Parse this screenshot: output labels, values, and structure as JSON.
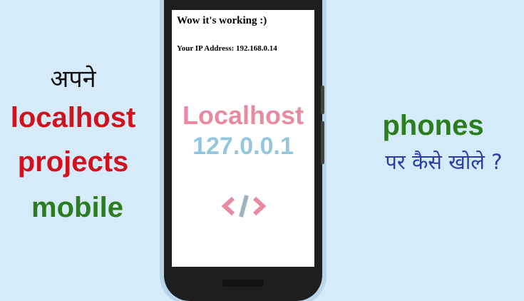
{
  "left": {
    "line1": "अपने",
    "line2": "localhost",
    "line3": "projects",
    "line4": "mobile"
  },
  "right": {
    "line1": "phones",
    "line2": "पर कैसे खोले ?"
  },
  "screen": {
    "heading": "Wow it's working :)",
    "ip_text": "Your IP Address: 192.168.0.14",
    "brand_word": "Localhost",
    "brand_ip": "127.0.0.1",
    "icon": "code-icon"
  },
  "colors": {
    "background": "#d5ebfa",
    "red": "#d0121d",
    "green": "#2b7d1e",
    "blue": "#2b3ea7",
    "pink": "#e98aa3",
    "light_blue": "#96c6dd"
  }
}
